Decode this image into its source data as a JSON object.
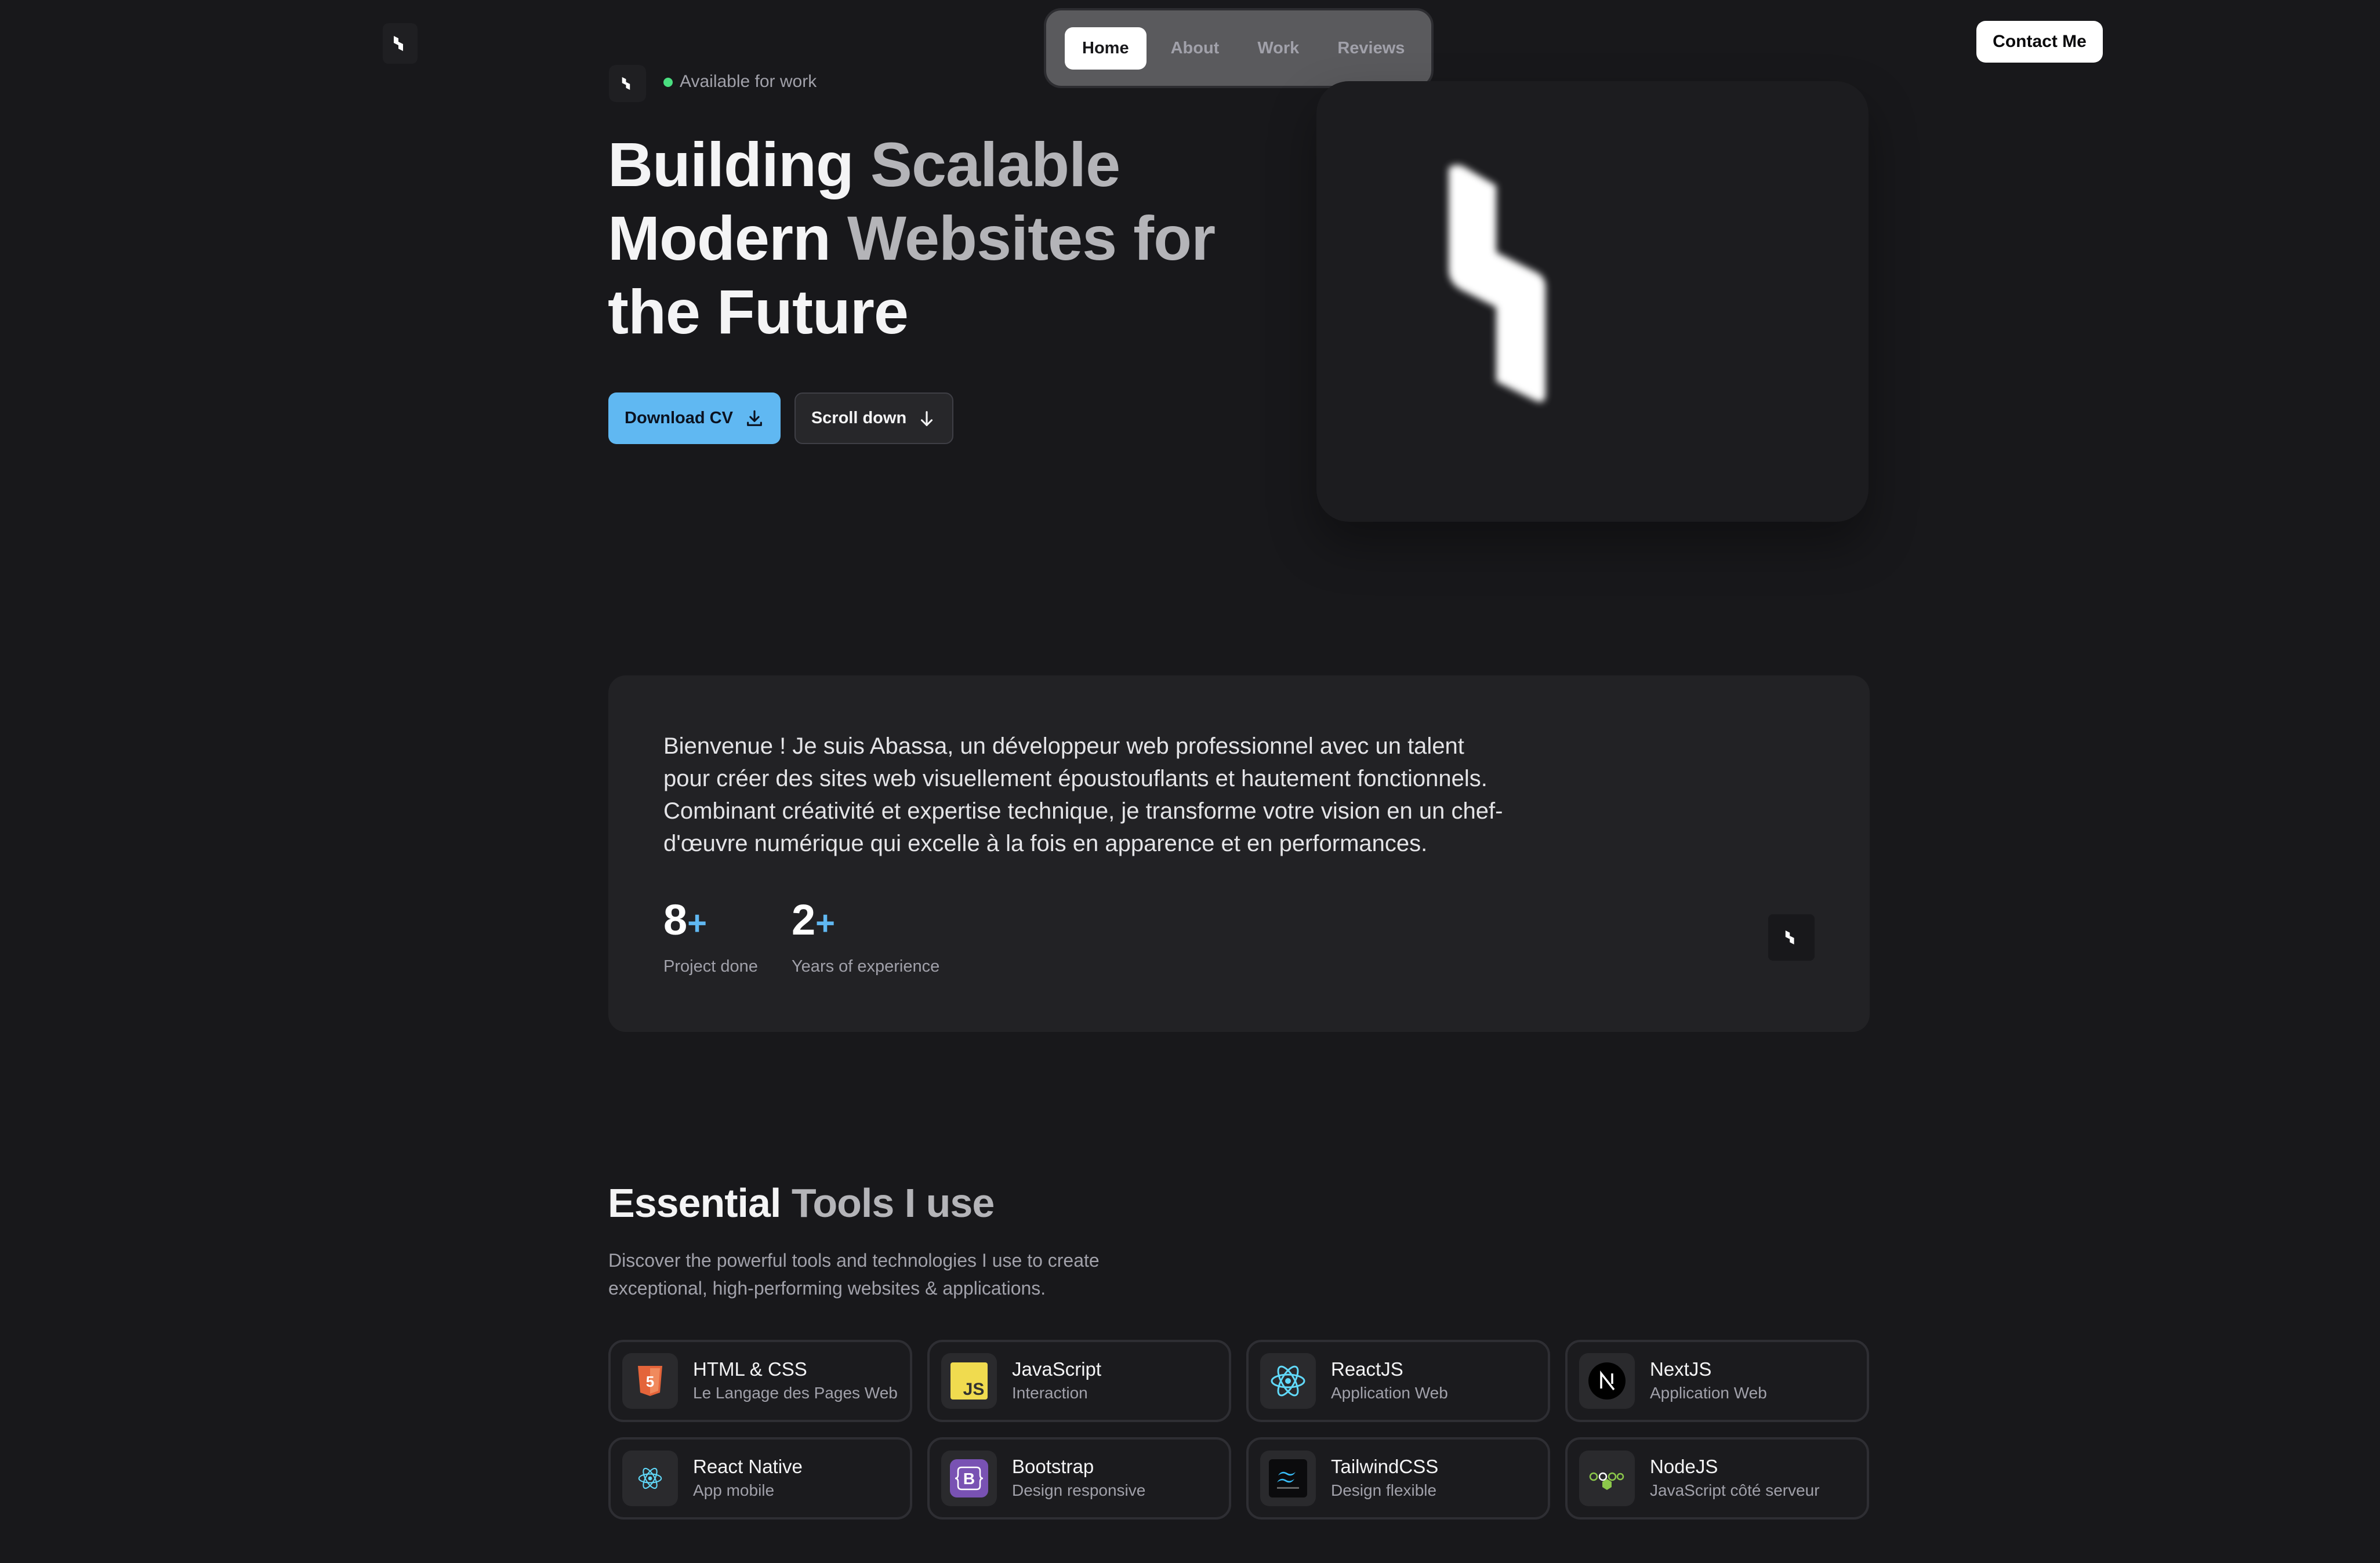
{
  "header": {
    "nav": [
      {
        "label": "Home",
        "active": true
      },
      {
        "label": "About",
        "active": false
      },
      {
        "label": "Work",
        "active": false
      },
      {
        "label": "Reviews",
        "active": false
      }
    ],
    "contact_label": "Contact Me"
  },
  "hero": {
    "status": "Available for work",
    "headline_lines": [
      [
        "Building ",
        "Scalable"
      ],
      [
        "Modern ",
        "Websites for"
      ],
      [
        "the Future",
        ""
      ]
    ],
    "download_label": "Download CV",
    "scroll_label": "Scroll down"
  },
  "about": {
    "intro": "Bienvenue ! Je suis Abassa, un développeur web professionnel avec un talent pour créer des sites web visuellement époustouflants et hautement fonctionnels. Combinant créativité et expertise technique, je transforme votre vision en un chef-d'œuvre numérique qui excelle à la fois en apparence et en performances.",
    "stats": [
      {
        "value": "8",
        "suffix": "+",
        "label": "Project done"
      },
      {
        "value": "2",
        "suffix": "+",
        "label": "Years of experience"
      }
    ]
  },
  "tools": {
    "title_main": "Essential ",
    "title_muted": "Tools I use",
    "description": "Discover the powerful tools and technologies I use to create exceptional, high-performing websites & applications.",
    "items": [
      {
        "name": "HTML & CSS",
        "sub": "Le Langage des Pages Web",
        "icon": "html5-icon"
      },
      {
        "name": "JavaScript",
        "sub": "Interaction",
        "icon": "javascript-icon"
      },
      {
        "name": "ReactJS",
        "sub": "Application Web",
        "icon": "react-icon"
      },
      {
        "name": "NextJS",
        "sub": "Application Web",
        "icon": "nextjs-icon"
      },
      {
        "name": "React Native",
        "sub": "App mobile",
        "icon": "react-native-icon"
      },
      {
        "name": "Bootstrap",
        "sub": "Design responsive",
        "icon": "bootstrap-icon"
      },
      {
        "name": "TailwindCSS",
        "sub": "Design flexible",
        "icon": "tailwind-icon"
      },
      {
        "name": "NodeJS",
        "sub": "JavaScript côté serveur",
        "icon": "nodejs-icon"
      }
    ]
  },
  "colors": {
    "background": "#18181b",
    "accent": "#60b8f2",
    "status": "#4ade80"
  }
}
